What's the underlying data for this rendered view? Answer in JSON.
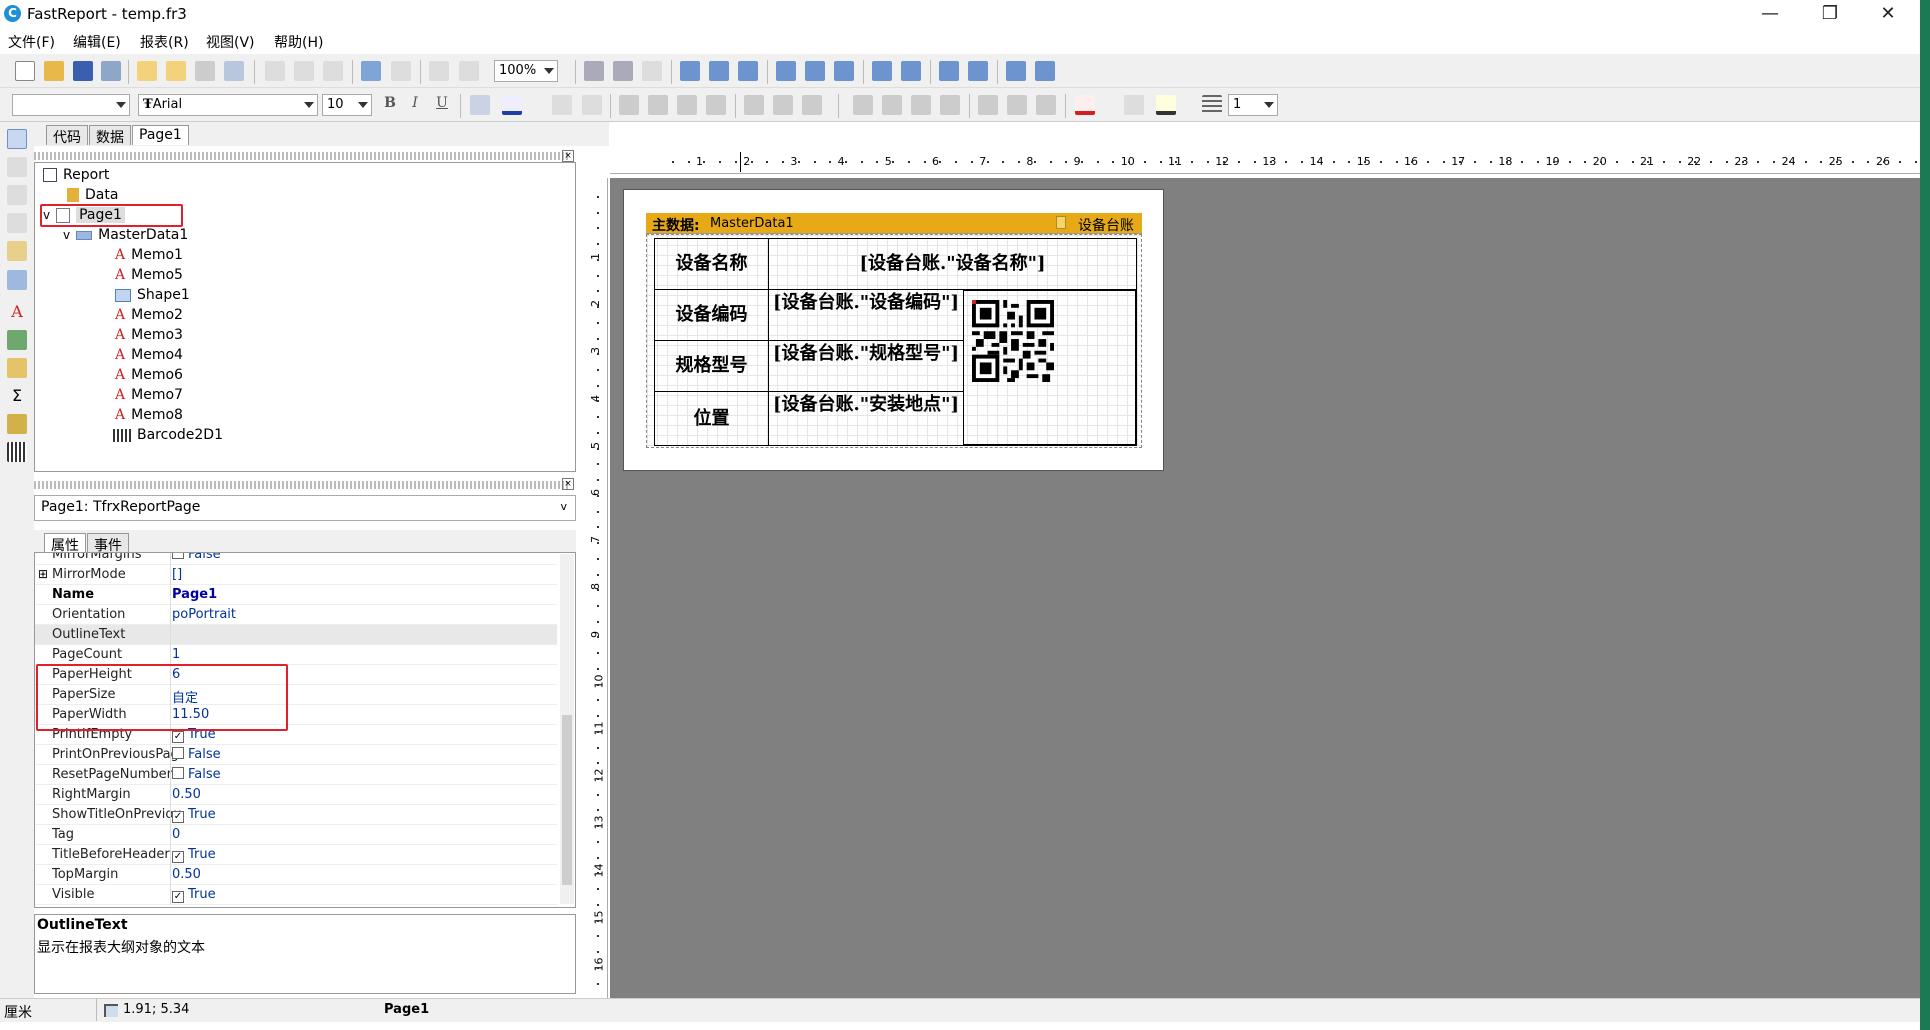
{
  "app": {
    "title": "FastReport - temp.fr3",
    "logo": "C"
  },
  "window_controls": {
    "minimize": "—",
    "maximize": "❐",
    "close": "✕"
  },
  "menu": [
    "文件(F)",
    "编辑(E)",
    "报表(R)",
    "视图(V)",
    "帮助(H)"
  ],
  "toolbar1": {
    "zoom": "100%"
  },
  "toolbar2": {
    "style_value": "",
    "font_name": "Arial",
    "font_size": "10",
    "bold": "B",
    "italic": "I",
    "underline": "U",
    "frame_width": "1"
  },
  "design_tabs": [
    "代码",
    "数据",
    "Page1"
  ],
  "tree": {
    "report": "Report",
    "data": "Data",
    "page1": "Page1",
    "masterdata": "MasterData1",
    "children": [
      "Memo1",
      "Memo5",
      "Shape1",
      "Memo2",
      "Memo3",
      "Memo4",
      "Memo6",
      "Memo7",
      "Memo8",
      "Barcode2D1"
    ]
  },
  "object_selector": "Page1: TfrxReportPage",
  "property_tabs": [
    "属性",
    "事件"
  ],
  "properties": [
    {
      "name": "MirrorMargins",
      "value": "False",
      "check": "off"
    },
    {
      "name": "MirrorMode",
      "value": "[]",
      "expand": "⊞"
    },
    {
      "name": "Name",
      "value": "Page1",
      "bold": true
    },
    {
      "name": "Orientation",
      "value": "poPortrait"
    },
    {
      "name": "OutlineText",
      "value": ""
    },
    {
      "name": "PageCount",
      "value": "1"
    },
    {
      "name": "PaperHeight",
      "value": "6"
    },
    {
      "name": "PaperSize",
      "value": "自定"
    },
    {
      "name": "PaperWidth",
      "value": "11.50"
    },
    {
      "name": "PrintIfEmpty",
      "value": "True",
      "check": "on"
    },
    {
      "name": "PrintOnPreviousPag",
      "value": "False",
      "check": "off"
    },
    {
      "name": "ResetPageNumbers",
      "value": "False",
      "check": "off"
    },
    {
      "name": "RightMargin",
      "value": "0.50"
    },
    {
      "name": "ShowTitleOnPreviou",
      "value": "True",
      "check": "on"
    },
    {
      "name": "Tag",
      "value": "0"
    },
    {
      "name": "TitleBeforeHeader",
      "value": "True",
      "check": "on"
    },
    {
      "name": "TopMargin",
      "value": "0.50"
    },
    {
      "name": "Visible",
      "value": "True",
      "check": "on"
    }
  ],
  "description": {
    "title": "OutlineText",
    "text": "显示在报表大纲对象的文本"
  },
  "status": {
    "unit": "厘米",
    "coords": "1.91; 5.34",
    "page": "Page1"
  },
  "ruler": {
    "h": [
      "1",
      "2",
      "3",
      "4",
      "5",
      "6",
      "7",
      "8",
      "9",
      "10",
      "11",
      "12",
      "13",
      "14",
      "15",
      "16",
      "17",
      "18",
      "19",
      "20",
      "21",
      "22",
      "23",
      "24",
      "25",
      "26"
    ],
    "v": [
      "1",
      "2",
      "3",
      "4",
      "5",
      "6",
      "7",
      "8",
      "9",
      "10",
      "11",
      "12",
      "13",
      "14",
      "15",
      "16"
    ]
  },
  "band": {
    "label_bold": "主数据:",
    "label": "MasterData1",
    "dataset": "设备台账"
  },
  "memos": {
    "name_label": "设备名称",
    "name_value": "[设备台账.\"设备名称\"]",
    "code_label": "设备编码",
    "code_value": "[设备台账.\"设备编码\"]",
    "spec_label": "规格型号",
    "spec_value": "[设备台账.\"规格型号\"]",
    "loc_label": "位置",
    "loc_value": "[设备台账.\"安装地点\"]"
  },
  "colors": {
    "band": "#e8a917",
    "highlight": "#e0202a",
    "canvas": "#808080"
  }
}
